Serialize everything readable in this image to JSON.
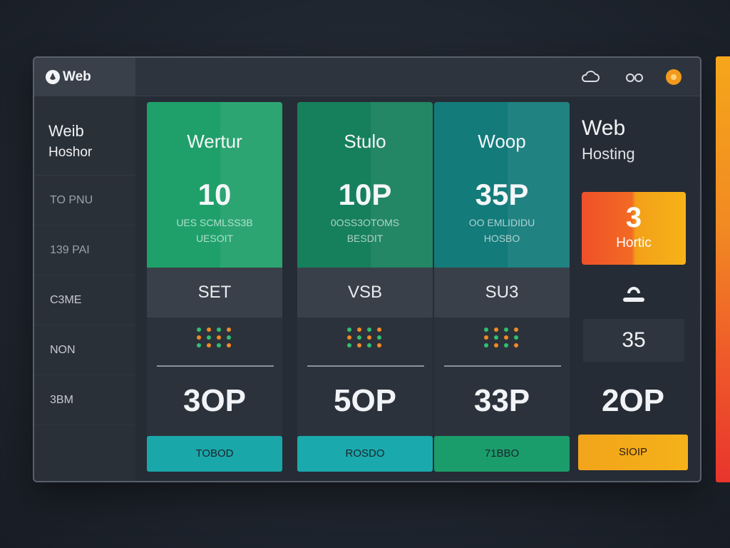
{
  "app": {
    "brand": "Web"
  },
  "sidebar": {
    "heading_line1": "Weib",
    "heading_line2": "Hoshor",
    "items": [
      {
        "label": "TO PNU"
      },
      {
        "label": "139 PAI"
      },
      {
        "label": "C3ME"
      },
      {
        "label": "NON"
      },
      {
        "label": "3BM"
      }
    ]
  },
  "plans": [
    {
      "name": "Wertur",
      "big": "10",
      "desc1": "UES SCMLSS3B",
      "desc2": "UESOIT",
      "mid": "SET",
      "price": "3OP",
      "cta": "TOBOD",
      "top_color": "#1fa06a",
      "cta_color": "#1aa7a9"
    },
    {
      "name": "Stulo",
      "big": "10P",
      "desc1": "0OSS3OTOMS",
      "desc2": "BESDIT",
      "mid": "VSB",
      "price": "5OP",
      "cta": "ROSDO",
      "top_color": "#167f5c",
      "cta_color": "#1aa9ad"
    },
    {
      "name": "Woop",
      "big": "35P",
      "desc1": "OO EMLIDIDU",
      "desc2": "HOSBO",
      "mid": "SU3",
      "price": "33P",
      "cta": "71BBO",
      "top_color": "#137b7a",
      "cta_color": "#1b9d6b"
    }
  ],
  "featured": {
    "title": "Web",
    "subtitle": "Hosting",
    "badge_number": "3",
    "badge_label": "Hortic",
    "stat": "35",
    "price": "2OP",
    "cta": "SIOIP"
  },
  "dot_colors": [
    "#2fbf71",
    "#f08a24",
    "#2fbf71",
    "#f08a24"
  ],
  "colors": {
    "background": "#1f2530",
    "accent_orange": "#f2a41a",
    "accent_teal": "#1aa7a9",
    "accent_green": "#1fa06a"
  }
}
